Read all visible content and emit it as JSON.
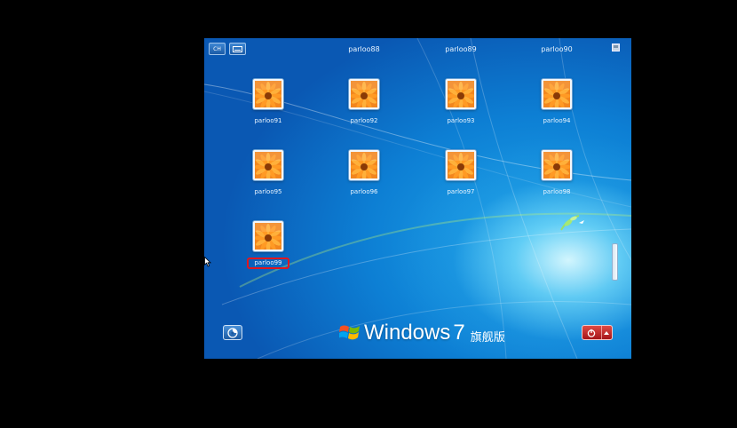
{
  "toolbar": {
    "ime_label": "CH",
    "keyboard_icon": "keyboard-icon"
  },
  "top_users": [
    {
      "name": "parloo88"
    },
    {
      "name": "parloo89"
    },
    {
      "name": "parloo90"
    }
  ],
  "users": [
    {
      "name": "parloo91",
      "selected": false
    },
    {
      "name": "parloo92",
      "selected": false
    },
    {
      "name": "parloo93",
      "selected": false
    },
    {
      "name": "parloo94",
      "selected": false
    },
    {
      "name": "parloo95",
      "selected": false
    },
    {
      "name": "parloo96",
      "selected": false
    },
    {
      "name": "parloo97",
      "selected": false
    },
    {
      "name": "parloo98",
      "selected": false
    },
    {
      "name": "parloo99",
      "selected": true
    }
  ],
  "branding": {
    "word": "Windows",
    "version": "7",
    "edition": "旗舰版"
  },
  "colors": {
    "selection": "#e0171f",
    "power": "#c62828",
    "background": "#0d7fd4"
  },
  "icons": {
    "access": "ease-of-access-icon",
    "power": "power-icon",
    "power_options": "chevron-up-icon",
    "avatar": "flower-avatar-icon",
    "corner": "window-icon"
  }
}
